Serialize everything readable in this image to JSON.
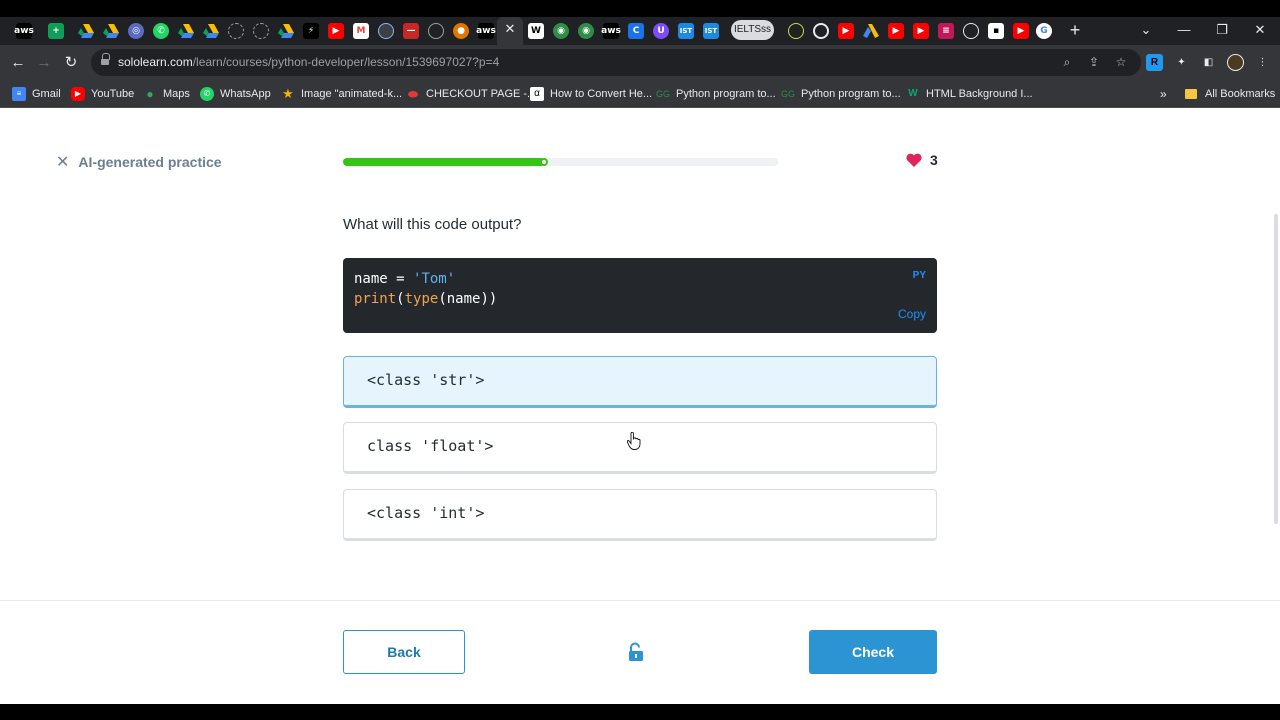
{
  "browser": {
    "active_tab_close": "✕",
    "ielts_tab_label": "IELTSss",
    "new_tab": "+",
    "url_host": "sololearn.com",
    "url_path": "/learn/courses/python-developer/lesson/1539697027?p=4",
    "bookmarks": [
      {
        "label": "Gmail",
        "color": "#4285f4"
      },
      {
        "label": "YouTube",
        "color": "#ff0000"
      },
      {
        "label": "Maps",
        "color": "#34a853"
      },
      {
        "label": "WhatsApp",
        "color": "#25d366"
      },
      {
        "label": "Image \"animated-k...",
        "color": "#f4b400"
      },
      {
        "label": "CHECKOUT PAGE -...",
        "color": "#e53935"
      },
      {
        "label": "How to Convert He...",
        "color": "#ffffff"
      },
      {
        "label": "Python program to...",
        "color": "#2f8d46"
      },
      {
        "label": "Python program to...",
        "color": "#2f8d46"
      },
      {
        "label": "HTML Background I...",
        "color": "#04aa6d"
      }
    ],
    "bookmarks_more": "»",
    "all_bookmarks": "All Bookmarks"
  },
  "lesson": {
    "exit_icon": "✕",
    "exit_label": "AI-generated practice",
    "progress": 0.465,
    "hearts": "3",
    "question": "What will this code output?",
    "code": {
      "language": "PY",
      "copy": "Copy",
      "line1": {
        "name": "name",
        "op": " = ",
        "value": "'Tom'"
      },
      "line2": {
        "fn1": "print",
        "p1": "(",
        "fn2": "type",
        "p2": "(",
        "arg": "name",
        "p3": "))"
      }
    },
    "options": [
      {
        "label": "<class 'str'>",
        "selected": true
      },
      {
        "label": "class 'float'>",
        "selected": false
      },
      {
        "label": "<class 'int'>",
        "selected": false
      }
    ],
    "back_label": "Back",
    "check_label": "Check"
  },
  "colors": {
    "accent": "#2d94d4",
    "progress": "#34c515",
    "heart": "#e0245e",
    "selected_bg": "#e6f5fd"
  }
}
